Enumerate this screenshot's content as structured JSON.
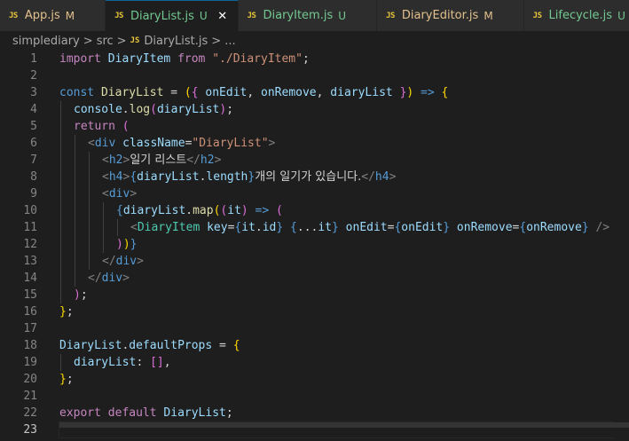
{
  "tabs": [
    {
      "name": "App.js",
      "status": "M",
      "state": "modified",
      "active": false
    },
    {
      "name": "DiaryList.js",
      "status": "U",
      "state": "untracked",
      "active": true
    },
    {
      "name": "DiaryItem.js",
      "status": "U",
      "state": "untracked",
      "active": false
    },
    {
      "name": "DiaryEditor.js",
      "status": "M",
      "state": "modified",
      "active": false
    },
    {
      "name": "Lifecycle.js",
      "status": "U",
      "state": "untracked",
      "active": false
    }
  ],
  "tab_icon_text": "JS",
  "breadcrumb": {
    "items": [
      "simplediary",
      "src",
      "DiaryList.js",
      "..."
    ],
    "separator": ">"
  },
  "editor": {
    "current_line": 23,
    "line_numbers": [
      "1",
      "2",
      "3",
      "4",
      "5",
      "6",
      "7",
      "8",
      "9",
      "10",
      "11",
      "12",
      "13",
      "14",
      "15",
      "16",
      "17",
      "18",
      "19",
      "20",
      "21",
      "22",
      "23"
    ],
    "code": {
      "l1": {
        "import": "import",
        "diaryitem": "DiaryItem",
        "from": "from",
        "path": "\"./DiaryItem\"",
        "semi": ";"
      },
      "l3": {
        "const": "const",
        "name": "DiaryList",
        "eq": " = ",
        "p1": "(",
        "b1": "{",
        "onEdit": "onEdit",
        "c1": ", ",
        "onRemove": "onRemove",
        "c2": ", ",
        "diaryList": "diaryList",
        "b2": "}",
        "p2": ")",
        "arrow": " => ",
        "b3": "{"
      },
      "l4": {
        "console": "console",
        "dot": ".",
        "log": "log",
        "p1": "(",
        "arg": "diaryList",
        "p2": ")",
        "semi": ";"
      },
      "l5": {
        "return": "return",
        "p": "("
      },
      "l6": {
        "open": "<",
        "tag": "div",
        "attr": "className",
        "eq": "=",
        "val": "\"DiaryList\"",
        "close": ">"
      },
      "l7": {
        "open": "<",
        "tag": "h2",
        "close": ">",
        "text": "일기 리스트",
        "end_open": "</",
        "end_tag": "h2",
        "end_close": ">"
      },
      "l8": {
        "open": "<",
        "tag": "h4",
        "close": ">",
        "b1": "{",
        "obj": "diaryList",
        "dot": ".",
        "prop": "length",
        "b2": "}",
        "text": "개의 일기가 있습니다.",
        "end_open": "</",
        "end_tag": "h4",
        "end_close": ">"
      },
      "l9": {
        "open": "<",
        "tag": "div",
        "close": ">"
      },
      "l10": {
        "b1": "{",
        "obj": "diaryList",
        "dot": ".",
        "map": "map",
        "p1": "(",
        "p2": "(",
        "it": "it",
        "p3": ")",
        "arrow": " => ",
        "p4": "("
      },
      "l11": {
        "open": "<",
        "tag": "DiaryItem",
        "key": "key",
        "eq1": "=",
        "kb1": "{",
        "it": "it",
        "dot": ".",
        "id": "id",
        "kb2": "}",
        "sb1": "{",
        "spread": "...",
        "it2": "it",
        "sb2": "}",
        "onEdit": "onEdit",
        "eq2": "=",
        "eb1": "{",
        "onEditV": "onEdit",
        "eb2": "}",
        "onRemove": "onRemove",
        "eq3": "=",
        "rb1": "{",
        "onRemoveV": "onRemove",
        "rb2": "}",
        "close": " />"
      },
      "l12": {
        "p1": ")",
        "p2": ")",
        "b": "}"
      },
      "l13": {
        "open": "</",
        "tag": "div",
        "close": ">"
      },
      "l14": {
        "open": "</",
        "tag": "div",
        "close": ">"
      },
      "l15": {
        "p": ")",
        "semi": ";"
      },
      "l16": {
        "b": "}",
        "semi": ";"
      },
      "l18": {
        "name": "DiaryList",
        "dot": ".",
        "prop": "defaultProps",
        "eq": " = ",
        "b": "{"
      },
      "l19": {
        "key": "diaryList",
        "colon": ": ",
        "arr": "[]",
        "comma": ","
      },
      "l20": {
        "b": "}",
        "semi": ";"
      },
      "l22": {
        "export": "export",
        "default": "default",
        "name": "DiaryList",
        "semi": ";"
      }
    }
  },
  "colors": {
    "modified": "#e2c08d",
    "untracked": "#73c991",
    "js_icon": "#e8c53b",
    "background": "#1e1e1e"
  }
}
